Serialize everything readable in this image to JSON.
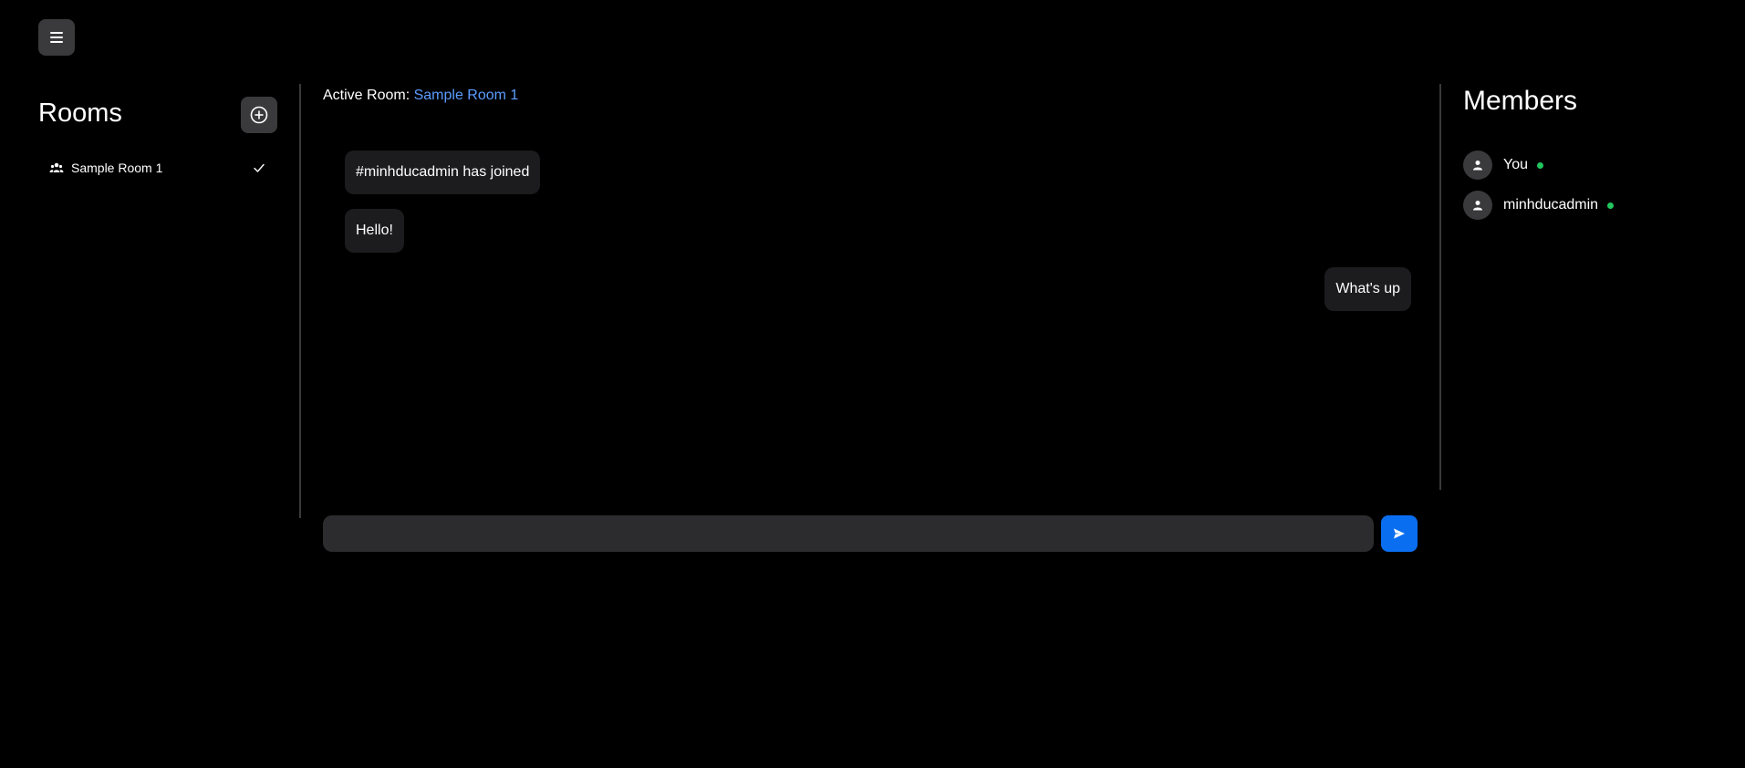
{
  "header": {
    "menu_icon": "hamburger-menu-icon"
  },
  "rooms": {
    "title": "Rooms",
    "add_icon": "plus-circle-icon",
    "items": [
      {
        "label": "Sample Room 1",
        "icon": "group-icon",
        "selected_icon": "check-icon"
      }
    ]
  },
  "chat": {
    "active_room_label": "Active Room: ",
    "active_room_name": "Sample Room 1",
    "messages": [
      {
        "text": "#minhducadmin has joined",
        "side": "left"
      },
      {
        "text": "Hello!",
        "side": "left"
      },
      {
        "text": "What's up",
        "side": "right"
      }
    ],
    "input": {
      "value": "",
      "placeholder": ""
    },
    "send_icon": "send-icon"
  },
  "members": {
    "title": "Members",
    "list": [
      {
        "name": "You",
        "status": "online",
        "avatar_icon": "user-icon"
      },
      {
        "name": "minhducadmin",
        "status": "online",
        "avatar_icon": "user-icon"
      }
    ]
  },
  "colors": {
    "background": "#000000",
    "panel": "#3a3a3c",
    "bubble": "#1c1c1e",
    "input": "#2c2c2e",
    "accent_link": "#5b9dff",
    "send_button": "#0a6ef0",
    "online": "#22c55e"
  }
}
